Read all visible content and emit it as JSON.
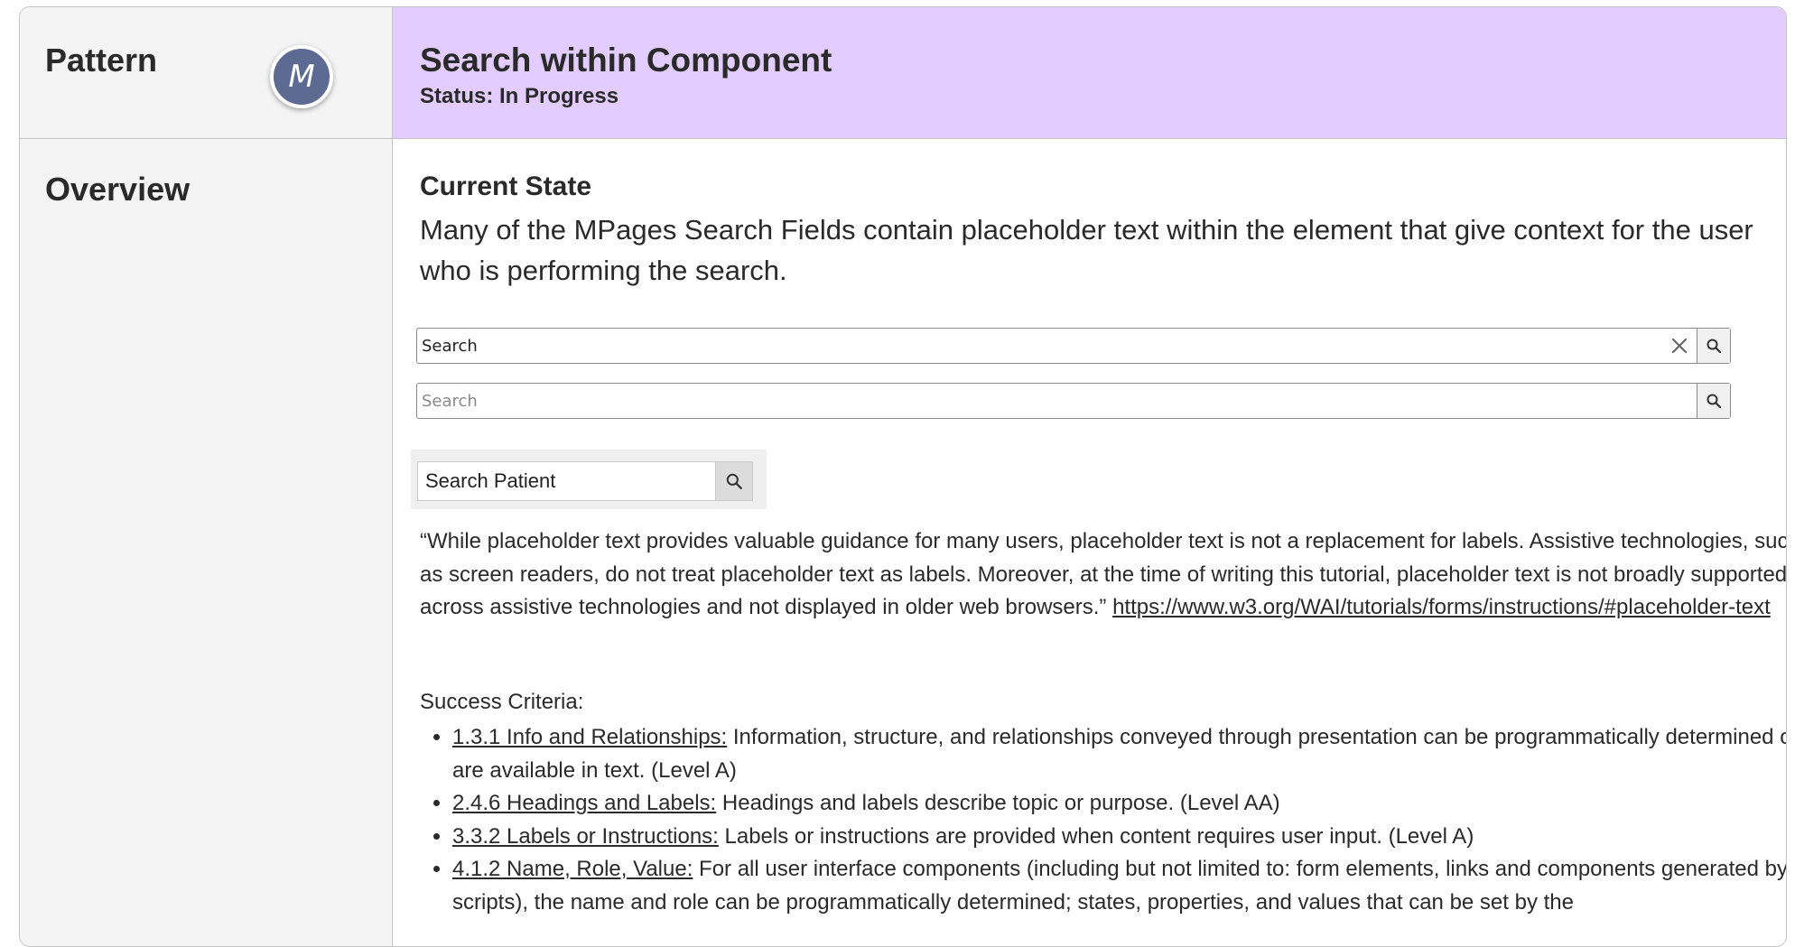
{
  "header": {
    "pattern_label": "Pattern",
    "avatar_initial": "M",
    "component_title": "Search within Component",
    "status": "Status: In Progress"
  },
  "overview": {
    "section_label": "Overview",
    "subheading": "Current State",
    "intro": "Many of the MPages Search Fields contain placeholder text within the element that give context for the user who is performing the search."
  },
  "examples": {
    "search_filled_value": "Search",
    "search_placeholder": "Search",
    "patient_search_value": "Search Patient"
  },
  "quote": {
    "text": "“While placeholder text provides valuable guidance for many users, placeholder text is not a replacement for labels. Assistive technologies, such as screen readers, do not treat placeholder text as labels. Moreover, at the time of writing this tutorial, placeholder text is not broadly supported across assistive technologies and not displayed in older web browsers.” ",
    "link": "https://www.w3.org/WAI/tutorials/forms/instructions/#placeholder-text"
  },
  "success_criteria": {
    "title": "Success Criteria:",
    "items": [
      {
        "link": "1.3.1 Info and Relationships:",
        "text": " Information, structure, and relationships conveyed through presentation can be programmatically determined or are available in text. (Level A)"
      },
      {
        "link": "2.4.6 Headings and Labels:",
        "text": " Headings and labels describe topic or purpose. (Level AA)"
      },
      {
        "link": "3.3.2 Labels or Instructions:",
        "text": " Labels or instructions are provided when content requires user input. (Level A)"
      },
      {
        "link": "4.1.2 Name, Role, Value:",
        "text": " For all user interface components (including but not limited to: form elements, links and components generated by scripts), the name and role can be programmatically determined; states, properties, and values that can be set by the"
      }
    ]
  },
  "colors": {
    "header_accent": "#e3ccff",
    "avatar_bg": "#5d6a92",
    "left_column_bg": "#f4f4f4"
  },
  "icons": [
    "search-icon",
    "close-icon"
  ]
}
